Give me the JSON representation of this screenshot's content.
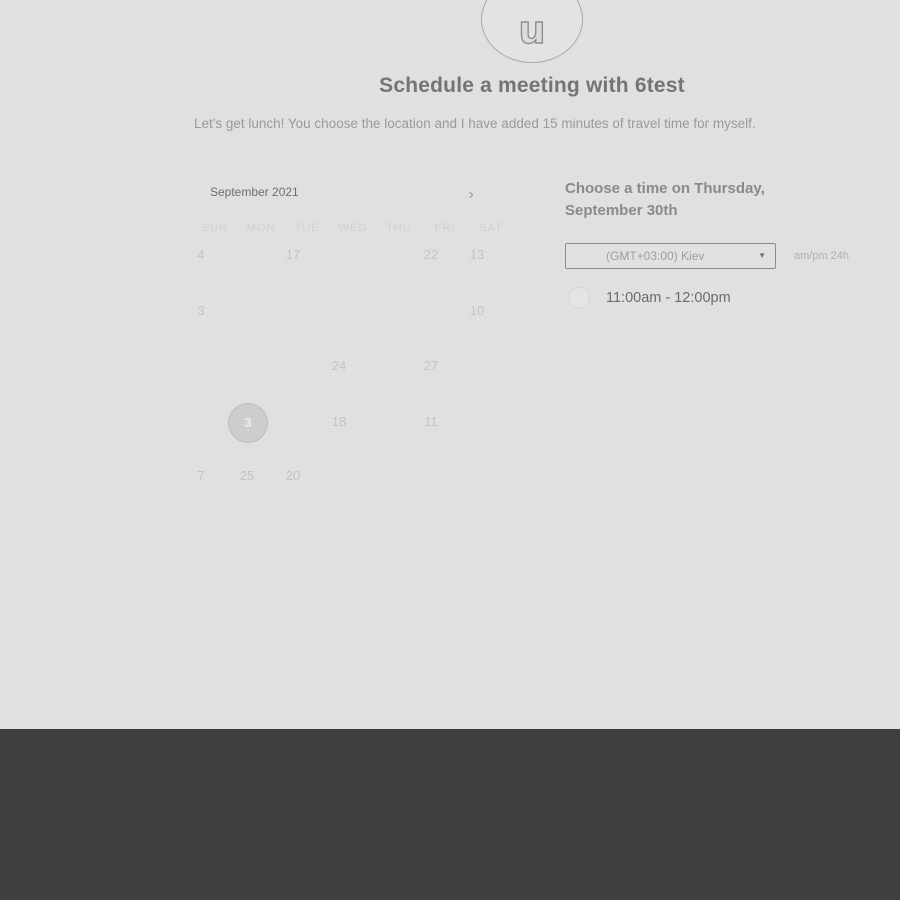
{
  "avatar": {
    "letter": "u"
  },
  "title": "Schedule a meeting with 6test",
  "description": "Let's get lunch! You choose the location and I have added 15 minutes of travel time for myself.",
  "calendar": {
    "month_label": "September 2021",
    "next_icon": "chevron-right-icon",
    "weekdays": [
      "SUN",
      "MON",
      "TUE",
      "WED",
      "THU",
      "FRI",
      "SAT"
    ],
    "days": [
      {
        "label": "4",
        "col": 0,
        "row": 0
      },
      {
        "label": "17",
        "col": 2,
        "row": 0
      },
      {
        "label": "22",
        "col": 5,
        "row": 0
      },
      {
        "label": "13",
        "col": 6,
        "row": 0
      },
      {
        "label": "3",
        "col": 0,
        "row": 1
      },
      {
        "label": "10",
        "col": 6,
        "row": 1
      },
      {
        "label": "24",
        "col": 3,
        "row": 2
      },
      {
        "label": "27",
        "col": 5,
        "row": 2
      },
      {
        "label": "3",
        "col": 1,
        "row": 3,
        "selected": true
      },
      {
        "label": "18",
        "col": 3,
        "row": 3
      },
      {
        "label": "11",
        "col": 5,
        "row": 3
      },
      {
        "label": "7",
        "col": 0,
        "row": 4
      },
      {
        "label": "25",
        "col": 1,
        "row": 4
      },
      {
        "label": "20",
        "col": 2,
        "row": 4
      }
    ]
  },
  "time_panel": {
    "heading": "Choose a time on Thursday, September 30th",
    "timezone": "(GMT+03:00) Kiev",
    "format_toggle": "am/pm  24h",
    "slots": [
      "11:00am - 12:00pm"
    ]
  },
  "colors": {
    "main_bg": "#e0e0e0",
    "footer_bg": "#404040"
  }
}
